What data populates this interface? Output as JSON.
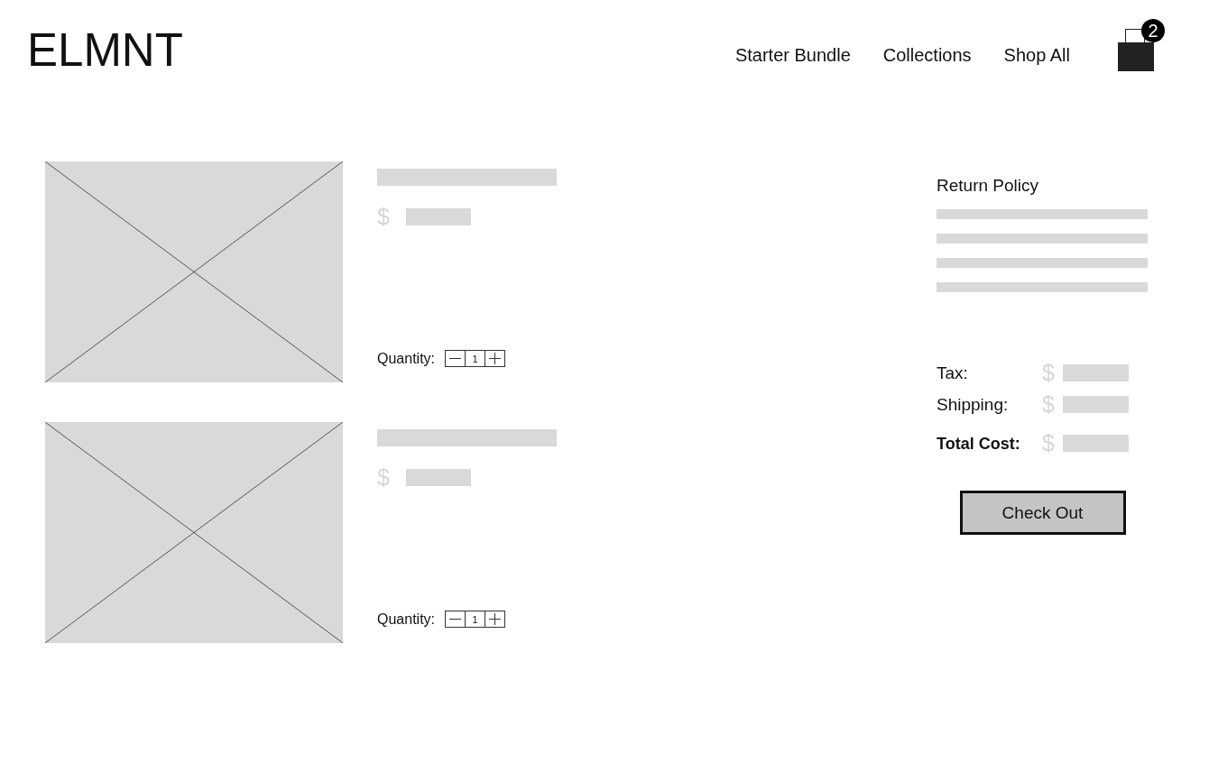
{
  "header": {
    "logo": "ELMNT",
    "nav": [
      {
        "label": "Starter Bundle"
      },
      {
        "label": "Collections"
      },
      {
        "label": "Shop All"
      }
    ],
    "cart_count": "2"
  },
  "cart_items": [
    {
      "currency": "$",
      "quantity_label": "Quantity:",
      "quantity": "1"
    },
    {
      "currency": "$",
      "quantity_label": "Quantity:",
      "quantity": "1"
    }
  ],
  "summary": {
    "title": "Return Policy",
    "rows": [
      {
        "kind": "line",
        "label": "Tax:",
        "currency": "$"
      },
      {
        "kind": "line",
        "label": "Shipping:",
        "currency": "$"
      },
      {
        "kind": "total",
        "label": "Total Cost:",
        "currency": "$"
      }
    ],
    "checkout_button": "Check Out"
  }
}
